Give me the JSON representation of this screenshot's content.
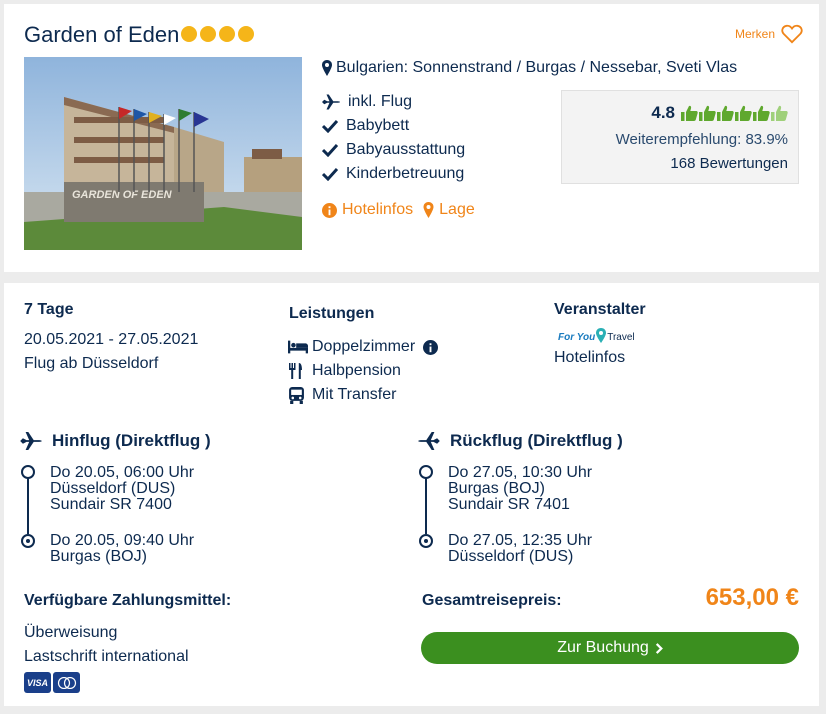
{
  "hotel": {
    "name": "Garden of Eden",
    "star_count": 4,
    "merken_label": "Merken",
    "location": "Bulgarien: Sonnenstrand / Burgas / Nessebar, Sveti Vlas",
    "image_sign_text": "GARDEN OF EDEN",
    "features": [
      "inkl. Flug",
      "Babybett",
      "Babyausstattung",
      "Kinderbetreuung"
    ],
    "links": {
      "hotelinfos": "Hotelinfos",
      "lage": "Lage"
    },
    "rating": {
      "score": "4.8",
      "thumbs_full": 5,
      "thumbs_partial": 1,
      "recommendation": "Weiterempfehlung: 83.9%",
      "reviews": "168 Bewertungen"
    }
  },
  "trip": {
    "duration": "7 Tage",
    "dates": "20.05.2021 - 27.05.2021",
    "departure": "Flug ab Düsseldorf",
    "services_title": "Leistungen",
    "services": [
      "Doppelzimmer",
      "Halbpension",
      "Mit Transfer"
    ],
    "organizer_title": "Veranstalter",
    "organizer_logo": {
      "part1": "For You",
      "part2": "Travel"
    },
    "organizer_link": "Hotelinfos"
  },
  "outbound": {
    "title": "Hinflug (Direktflug )",
    "dep_time": "Do 20.05, 06:00 Uhr",
    "dep_airport": "Düsseldorf (DUS)",
    "flight_no": "Sundair SR 7400",
    "arr_time": "Do 20.05, 09:40 Uhr",
    "arr_airport": "Burgas (BOJ)"
  },
  "return": {
    "title": "Rückflug (Direktflug )",
    "dep_time": "Do 27.05, 10:30 Uhr",
    "dep_airport": "Burgas (BOJ)",
    "flight_no": "Sundair SR 7401",
    "arr_time": "Do 27.05, 12:35 Uhr",
    "arr_airport": "Düsseldorf (DUS)"
  },
  "payment": {
    "title": "Verfügbare Zahlungsmittel:",
    "methods": [
      "Überweisung",
      "Lastschrift international"
    ],
    "card_visa": "VISA"
  },
  "price": {
    "label": "Gesamtreisepreis:",
    "value": "653,00 €"
  },
  "booking_button": "Zur Buchung",
  "colors": {
    "primary_text": "#0d2a4f",
    "accent_orange": "#f08519",
    "star_yellow": "#f5b519",
    "button_green": "#3b8f1f",
    "thumb_green": "#5fa82e"
  }
}
